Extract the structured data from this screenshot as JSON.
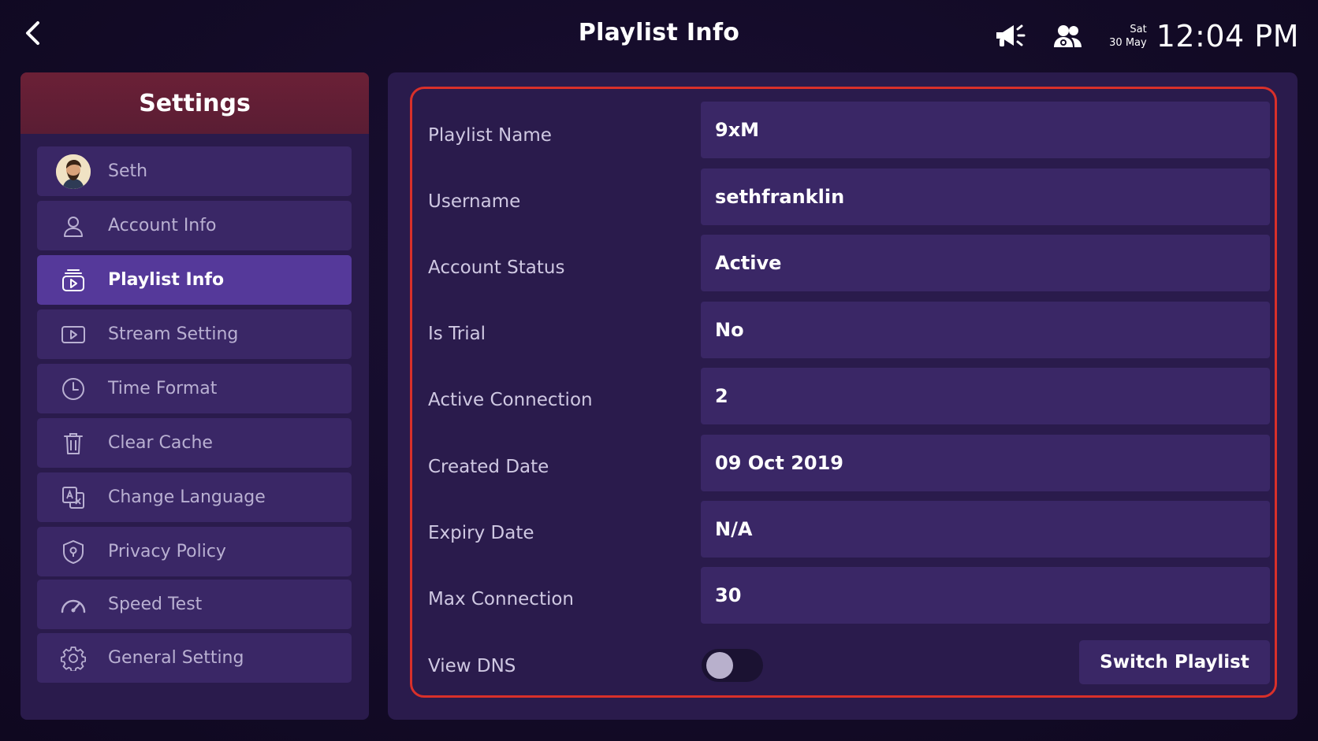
{
  "header": {
    "title": "Playlist Info",
    "day": "Sat",
    "date": "30 May",
    "time": "12:04 PM"
  },
  "icons": {
    "back": "chevron-left-icon",
    "announcements": "megaphone-icon",
    "users": "users-icon"
  },
  "sidebar": {
    "title": "Settings",
    "items": [
      {
        "label": "Seth",
        "icon": "avatar"
      },
      {
        "label": "Account Info",
        "icon": "user-icon"
      },
      {
        "label": "Playlist Info",
        "icon": "playlist-icon",
        "active": true
      },
      {
        "label": "Stream Setting",
        "icon": "play-icon"
      },
      {
        "label": "Time Format",
        "icon": "clock-icon"
      },
      {
        "label": "Clear Cache",
        "icon": "trash-icon"
      },
      {
        "label": "Change Language",
        "icon": "translate-icon"
      },
      {
        "label": "Privacy Policy",
        "icon": "shield-icon"
      },
      {
        "label": "Speed Test",
        "icon": "speedometer-icon"
      },
      {
        "label": "General Setting",
        "icon": "gear-icon"
      }
    ]
  },
  "info": {
    "rows": [
      {
        "label": "Playlist Name",
        "value": "9xM"
      },
      {
        "label": "Username",
        "value": "sethfranklin"
      },
      {
        "label": "Account Status",
        "value": "Active"
      },
      {
        "label": "Is Trial",
        "value": "No"
      },
      {
        "label": "Active Connection",
        "value": "2"
      },
      {
        "label": "Created Date",
        "value": "09 Oct 2019"
      },
      {
        "label": "Expiry Date",
        "value": "N/A"
      },
      {
        "label": "Max Connection",
        "value": "30"
      }
    ],
    "view_dns_label": "View DNS",
    "view_dns_enabled": false,
    "switch_playlist_label": "Switch Playlist"
  },
  "colors": {
    "background": "#130b27",
    "panel": "#2a1b4c",
    "item": "#3a2766",
    "active_item": "#55399a",
    "header_red": "#6b2036",
    "highlight_border": "#d9302a"
  }
}
